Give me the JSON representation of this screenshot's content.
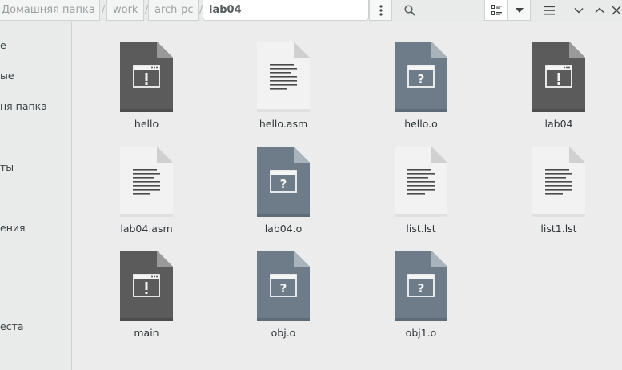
{
  "breadcrumb": [
    {
      "label": "Домашняя папка"
    },
    {
      "label": "work"
    },
    {
      "label": "arch-pc"
    },
    {
      "label": "lab04"
    }
  ],
  "breadcrumb_separator": "/",
  "header_icons": {
    "menu": "vertical-dots-icon",
    "search": "search-icon",
    "view_mode": "icon-view-icon",
    "view_options": "dropdown-arrow-icon",
    "main_menu": "hamburger-icon",
    "minimize": "minimize-icon",
    "maximize": "maximize-icon",
    "close": "close-icon"
  },
  "sidebar": {
    "items": [
      {
        "label": "е"
      },
      {
        "label": "ые"
      },
      {
        "label": "ня папка"
      },
      {
        "label": "ты"
      },
      {
        "label": "ения"
      },
      {
        "label": "еста"
      }
    ]
  },
  "files": [
    {
      "name": "hello",
      "kind": "executable"
    },
    {
      "name": "hello.asm",
      "kind": "text"
    },
    {
      "name": "hello.o",
      "kind": "unknown"
    },
    {
      "name": "lab04",
      "kind": "executable"
    },
    {
      "name": "lab04.asm",
      "kind": "text"
    },
    {
      "name": "lab04.o",
      "kind": "unknown"
    },
    {
      "name": "list.lst",
      "kind": "text"
    },
    {
      "name": "list1.lst",
      "kind": "text"
    },
    {
      "name": "main",
      "kind": "executable"
    },
    {
      "name": "obj.o",
      "kind": "unknown"
    },
    {
      "name": "obj1.o",
      "kind": "unknown"
    }
  ],
  "colors": {
    "executable": "#5b5b5b",
    "unknown": "#6e7c89",
    "text": "#f2f2f2"
  }
}
